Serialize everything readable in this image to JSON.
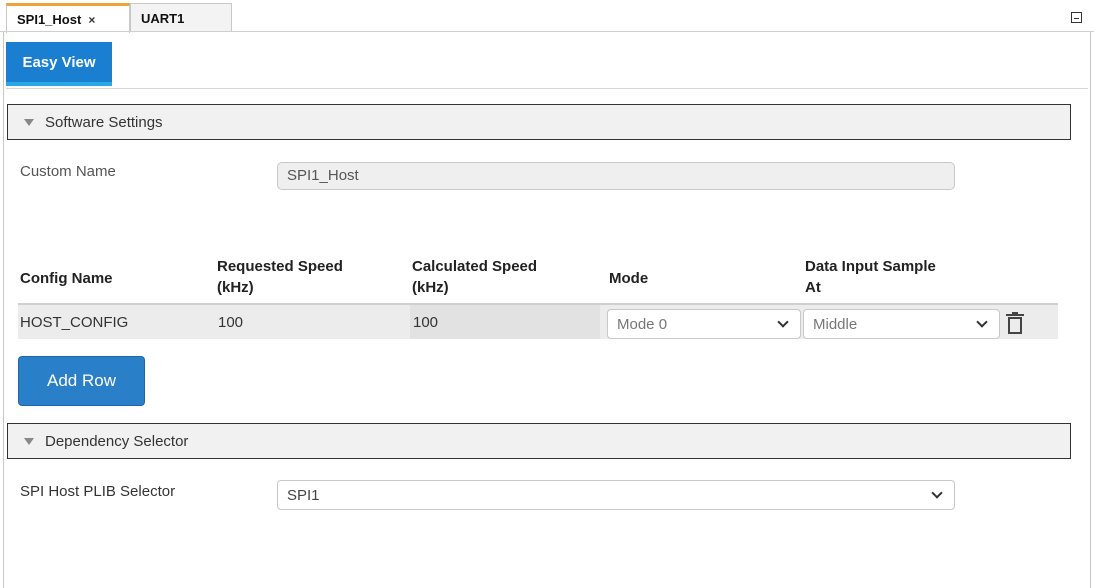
{
  "tabs": [
    {
      "label": "SPI1_Host",
      "active": true,
      "closable": true
    },
    {
      "label": "UART1",
      "active": false,
      "closable": false
    }
  ],
  "close_glyph": "×",
  "view_tab": {
    "label": "Easy View"
  },
  "software_settings": {
    "title": "Software Settings",
    "custom_name_label": "Custom Name",
    "custom_name_value": "SPI1_Host"
  },
  "config_table": {
    "headers": {
      "config_name": "Config Name",
      "requested_speed": [
        "Requested Speed",
        "(kHz)"
      ],
      "calculated_speed": [
        "Calculated Speed",
        "(kHz)"
      ],
      "mode": "Mode",
      "data_input_sample": [
        "Data Input Sample",
        "At"
      ]
    },
    "rows": [
      {
        "config_name": "HOST_CONFIG",
        "requested_speed": "100",
        "calculated_speed": "100",
        "mode": "Mode 0",
        "data_input_sample": "Middle"
      }
    ],
    "add_row_label": "Add Row"
  },
  "dependency_selector": {
    "title": "Dependency Selector",
    "plib_label": "SPI Host PLIB Selector",
    "plib_value": "SPI1"
  },
  "colors": {
    "accent": "#1a7fd0",
    "tab_active_border": "#f2a03a",
    "button": "#2a7fc9"
  }
}
